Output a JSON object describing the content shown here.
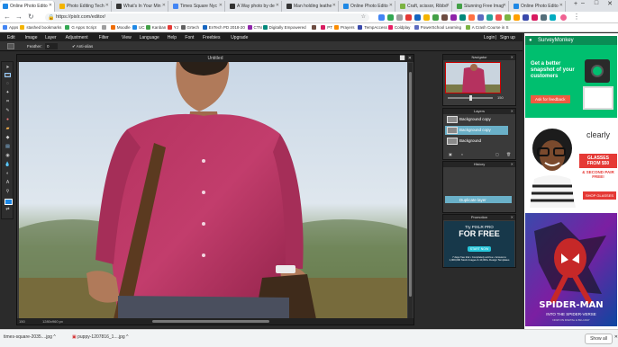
{
  "browser": {
    "tabs": [
      {
        "label": "Online Photo Edito",
        "fav": "#1e88e5",
        "active": true
      },
      {
        "label": "Photo Editing Tech",
        "fav": "#f4b400"
      },
      {
        "label": "What's In Your Min",
        "fav": "#333333"
      },
      {
        "label": "Times Square Nyc",
        "fav": "#4285f4"
      },
      {
        "label": "A Way photo by de",
        "fav": "#333333"
      },
      {
        "label": "Man holding leathe",
        "fav": "#333333"
      },
      {
        "label": "Online Photo Edito",
        "fav": "#1e88e5"
      },
      {
        "label": "Craft, scissor, Ribbo",
        "fav": "#7cb342"
      },
      {
        "label": "Stunning Free Imag",
        "fav": "#43a047"
      },
      {
        "label": "Online Photo Edito",
        "fav": "#1e88e5"
      }
    ],
    "url": "https://pixlr.com/editor/",
    "bookmarks": [
      "Apps",
      "stashed bookmarks",
      "G Apps Script",
      "",
      "Moodle",
      "UC",
      "Kanban",
      "YJ",
      "Grtech",
      "EnTech PD 2018-20",
      "CTN",
      "Digitally Empowered",
      "",
      "PT",
      "Prayers",
      "TempAccess",
      "Coldplay",
      "PowerSchool Learning",
      "A Crash Course in S"
    ]
  },
  "pixlr": {
    "menu": [
      "Edit",
      "Image",
      "Layer",
      "Adjustment",
      "Filter",
      "View",
      "Language",
      "Help",
      "Font",
      "Freebies",
      "Upgrade"
    ],
    "login": "Login",
    "signup": "Sign up",
    "sep": "|",
    "options": {
      "feather_label": "Feather:",
      "feather_value": "0",
      "antialias": "Anti-alias"
    },
    "canvas_title": "Untitled",
    "zoom": "150",
    "dimensions": "1280x960 px",
    "navigator": {
      "title": "Navigator",
      "zoom": "150"
    },
    "layers": {
      "title": "Layers",
      "items": [
        "Background copy",
        "Background copy",
        "Background"
      ]
    },
    "history": {
      "title": "History",
      "items": [
        "",
        "",
        "",
        "Duplicate layer"
      ]
    },
    "promotion": {
      "title": "Promotion",
      "line1": "Try PIXLR PRO",
      "line2": "FOR FREE",
      "cta": "START NOW",
      "fine": "7 days free trial • Completely ad-free • Access to 1,000,000 Stock Images & 10,000+ Design Templates"
    }
  },
  "ads": {
    "surveymonkey": {
      "brand": "SurveyMonkey",
      "text": "Get a better snapshot of your customers",
      "cta": "Ask for feedback"
    },
    "clearly": {
      "brand": "clearly",
      "offer1": "GLASSES FROM $50",
      "offer2": "& SECOND PAIR FREE!",
      "cta": "SHOP GLASSES"
    },
    "spiderman": {
      "title": "SPIDER-MAN",
      "subtitle": "INTO THE SPIDER-VERSE",
      "fine": "NOW ON DIGITAL & BLU-RAY"
    }
  },
  "downloads": {
    "items": [
      "times-square-2035....jpg",
      "puppy-1207816_1....jpg"
    ],
    "show_all": "Show all"
  }
}
